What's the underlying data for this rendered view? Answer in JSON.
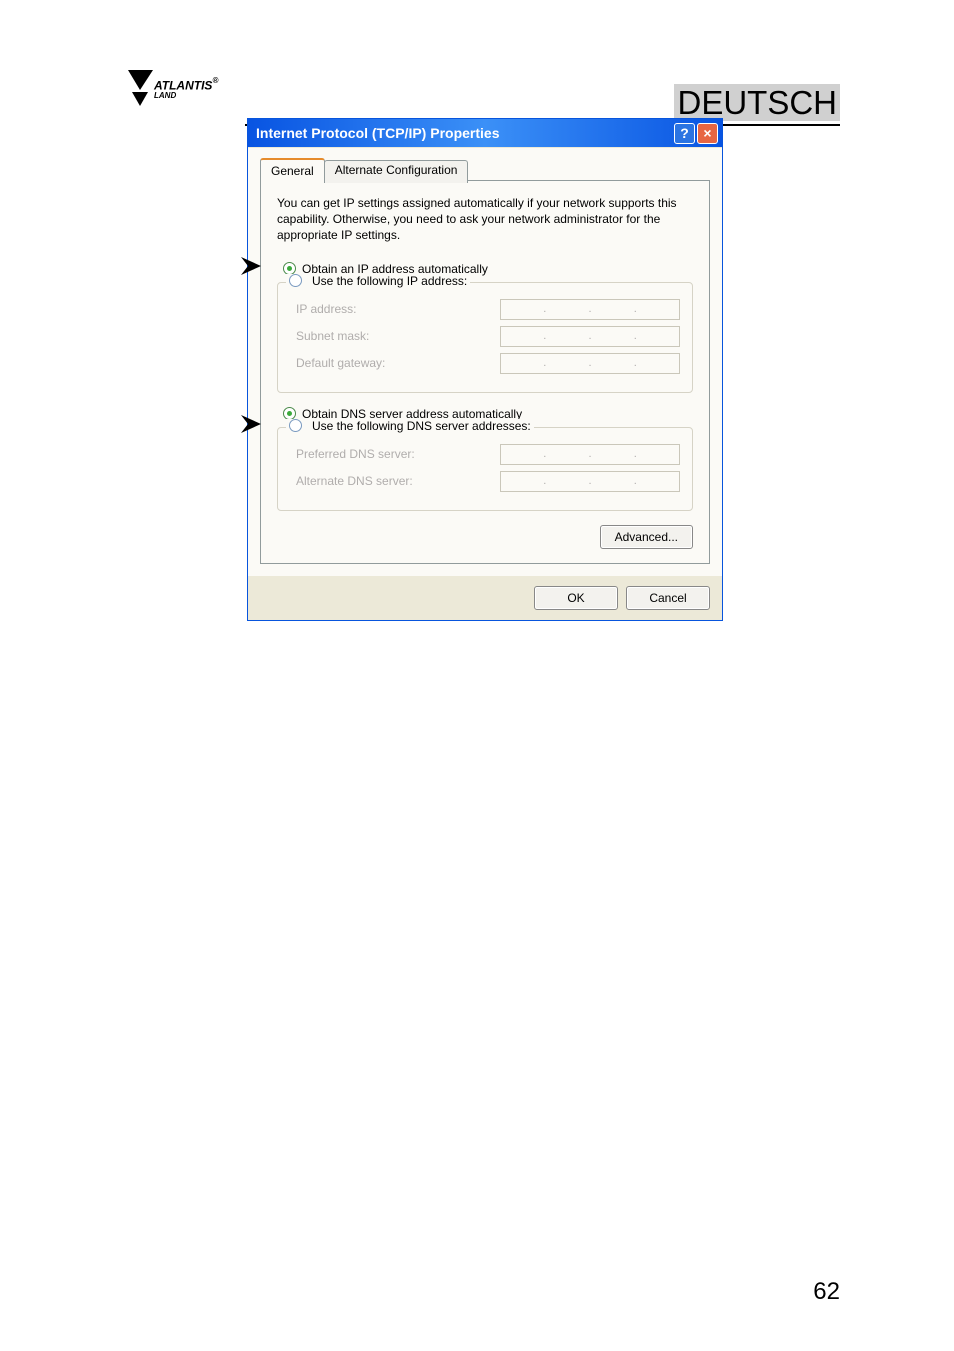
{
  "brand": {
    "name": "ATLANTIS",
    "sub": "LAND",
    "reg": "®"
  },
  "header": {
    "lang": "DEUTSCH"
  },
  "dialog": {
    "title": "Internet Protocol (TCP/IP) Properties",
    "help": "?",
    "close": "×",
    "tabs": {
      "general": "General",
      "alternate": "Alternate Configuration"
    },
    "intro": "You can get IP settings assigned automatically if your network supports this capability. Otherwise, you need to ask your network administrator for the appropriate IP settings.",
    "ip": {
      "auto": "Obtain an IP address automatically",
      "manual": "Use the following IP address:",
      "ip_label": "IP address:",
      "subnet_label": "Subnet mask:",
      "gateway_label": "Default gateway:"
    },
    "dns": {
      "auto": "Obtain DNS server address automatically",
      "manual": "Use the following DNS server addresses:",
      "preferred": "Preferred DNS server:",
      "alternate": "Alternate DNS server:"
    },
    "advanced": "Advanced...",
    "ok": "OK",
    "cancel": "Cancel"
  },
  "page_number": "62"
}
